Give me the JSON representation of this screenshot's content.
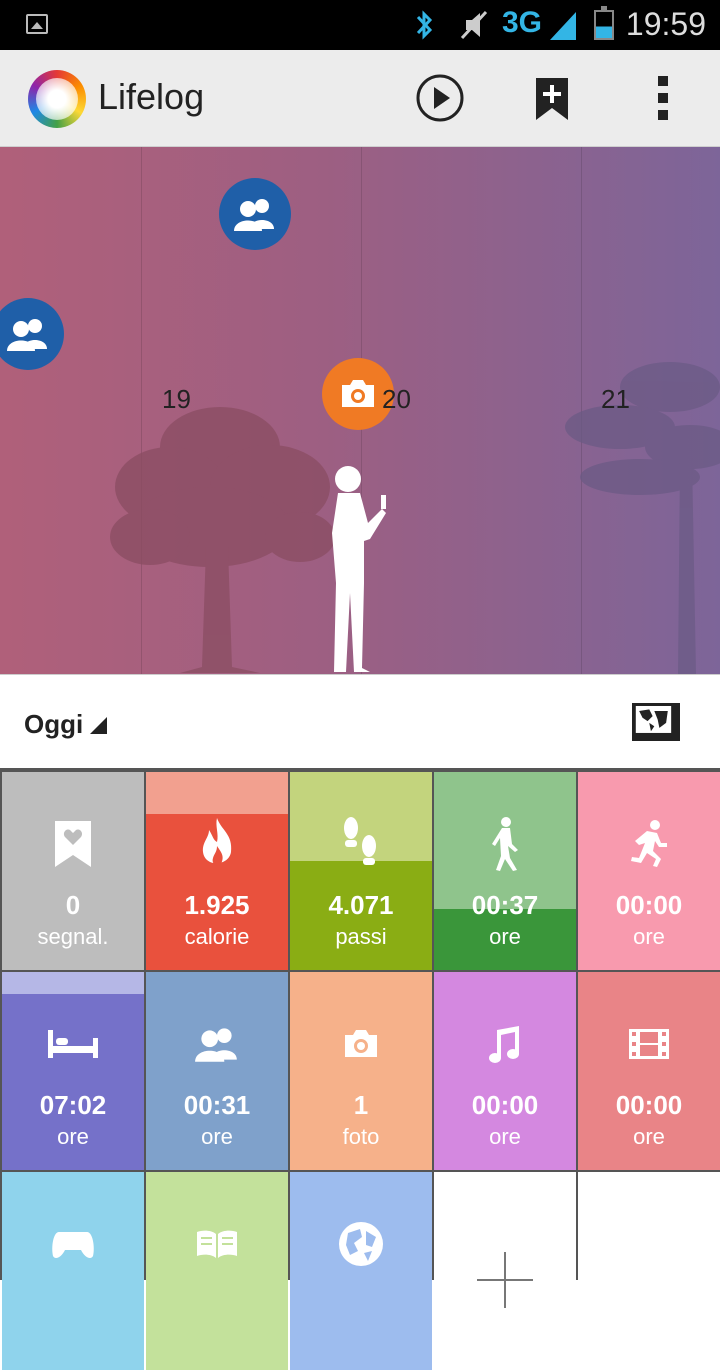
{
  "status_bar": {
    "time": "19:59",
    "network": "3G",
    "icons": [
      "image-icon",
      "bluetooth-icon",
      "mute-icon",
      "signal-icon",
      "battery-icon"
    ]
  },
  "action_bar": {
    "title": "Lifelog",
    "actions": [
      "play-icon",
      "bookmark-add-icon",
      "overflow-menu-icon"
    ]
  },
  "timeline": {
    "hours": [
      "19",
      "20",
      "21"
    ],
    "events": [
      "people-icon",
      "people-icon",
      "camera-icon"
    ],
    "colors": {
      "people": "#1f5fa8",
      "camera": "#f07a24"
    }
  },
  "date_bar": {
    "label": "Oggi",
    "map_icon": "world-map-icon"
  },
  "tiles": [
    {
      "icon": "bookmark-heart-icon",
      "value": "0",
      "unit": "segnal.",
      "color": "#bdbdbd",
      "top_color": "#bdbdbd",
      "fill": 0
    },
    {
      "icon": "flame-icon",
      "value": "1.925",
      "unit": "calorie",
      "color": "#f2a08f",
      "top_color": "#e9513d",
      "fill": 0.79
    },
    {
      "icon": "footsteps-icon",
      "value": "4.071",
      "unit": "passi",
      "color": "#c3d47d",
      "top_color": "#8aad14",
      "fill": 0.55
    },
    {
      "icon": "walking-icon",
      "value": "00:37",
      "unit": "ore",
      "color": "#8fc48c",
      "top_color": "#3a963a",
      "fill": 0.31
    },
    {
      "icon": "running-icon",
      "value": "00:00",
      "unit": "ore",
      "color": "#f89aae",
      "top_color": "#f89aae",
      "fill": 0
    },
    {
      "icon": "bed-icon",
      "value": "07:02",
      "unit": "ore",
      "color": "#b5b7e6",
      "top_color": "#7571c9",
      "fill": 0.89
    },
    {
      "icon": "people-icon",
      "value": "00:31",
      "unit": "ore",
      "color": "#7fa1cb",
      "top_color": "#7fa1cb",
      "fill": 0
    },
    {
      "icon": "camera-icon",
      "value": "1",
      "unit": "foto",
      "color": "#f6b18a",
      "top_color": "#f6b18a",
      "fill": 0
    },
    {
      "icon": "music-note-icon",
      "value": "00:00",
      "unit": "ore",
      "color": "#d488e0",
      "top_color": "#d488e0",
      "fill": 0
    },
    {
      "icon": "film-icon",
      "value": "00:00",
      "unit": "ore",
      "color": "#e98487",
      "top_color": "#e98487",
      "fill": 0
    },
    {
      "icon": "gamepad-icon",
      "value": "",
      "unit": "",
      "color": "#8fd3ec",
      "top_color": "#8fd3ec",
      "fill": 0
    },
    {
      "icon": "book-icon",
      "value": "",
      "unit": "",
      "color": "#c3e19b",
      "top_color": "#c3e19b",
      "fill": 0
    },
    {
      "icon": "globe-icon",
      "value": "",
      "unit": "",
      "color": "#9dbcee",
      "top_color": "#9dbcee",
      "fill": 0
    },
    {
      "icon": "add-icon",
      "value": "",
      "unit": "",
      "color": "#ffffff",
      "top_color": "#ffffff",
      "fill": 0
    },
    {
      "icon": "",
      "value": "",
      "unit": "",
      "color": "#ffffff",
      "top_color": "#ffffff",
      "fill": 0
    }
  ]
}
